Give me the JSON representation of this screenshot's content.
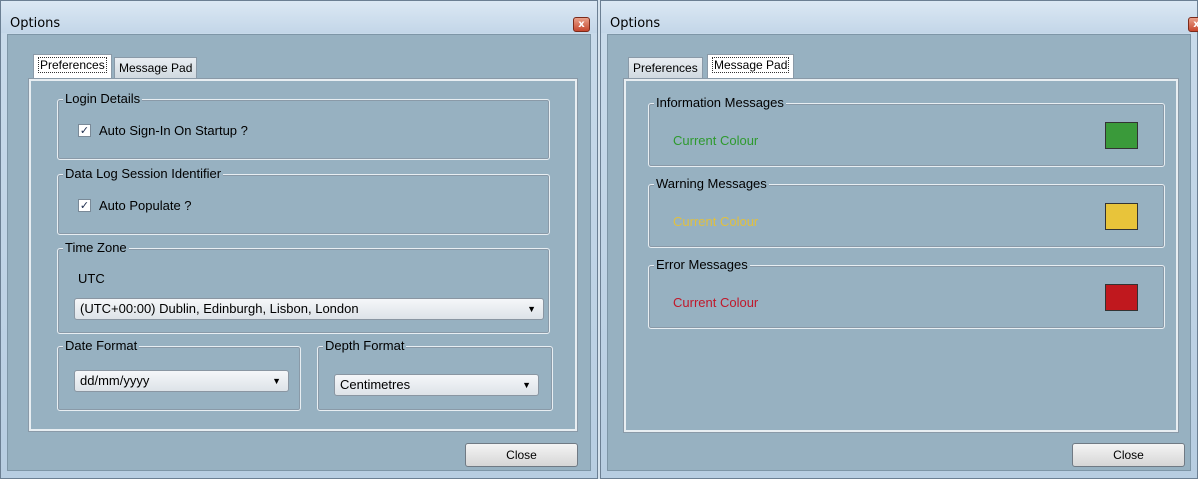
{
  "left_window": {
    "title": "Options",
    "close_glyph": "x",
    "tabs": [
      {
        "label": "Preferences",
        "active": true
      },
      {
        "label": "Message Pad",
        "active": false
      }
    ],
    "login_details": {
      "legend": "Login Details",
      "checkbox_label": "Auto Sign-In On Startup ?",
      "checked": true
    },
    "data_log": {
      "legend": "Data Log Session Identifier",
      "checkbox_label": "Auto Populate ?",
      "checked": true
    },
    "time_zone": {
      "legend": "Time Zone",
      "current": "UTC",
      "selected": "(UTC+00:00) Dublin, Edinburgh, Lisbon, London"
    },
    "date_format": {
      "legend": "Date Format",
      "selected": "dd/mm/yyyy"
    },
    "depth_format": {
      "legend": "Depth Format",
      "selected": "Centimetres"
    },
    "close_button": "Close"
  },
  "right_window": {
    "title": "Options",
    "close_glyph": "x",
    "tabs": [
      {
        "label": "Preferences",
        "active": false
      },
      {
        "label": "Message Pad",
        "active": true
      }
    ],
    "groups": [
      {
        "legend": "Information Messages",
        "label": "Current Colour",
        "label_color": "#2e9a2e",
        "swatch_color": "#3a9a3a"
      },
      {
        "legend": "Warning Messages",
        "label": "Current Colour",
        "label_color": "#e0c040",
        "swatch_color": "#e8c43a"
      },
      {
        "legend": "Error Messages",
        "label": "Current Colour",
        "label_color": "#c0182a",
        "swatch_color": "#c0181e"
      }
    ],
    "close_button": "Close"
  },
  "icons": {
    "checkbox_check": "check-mark",
    "dropdown_arrow": "triangle-down"
  }
}
